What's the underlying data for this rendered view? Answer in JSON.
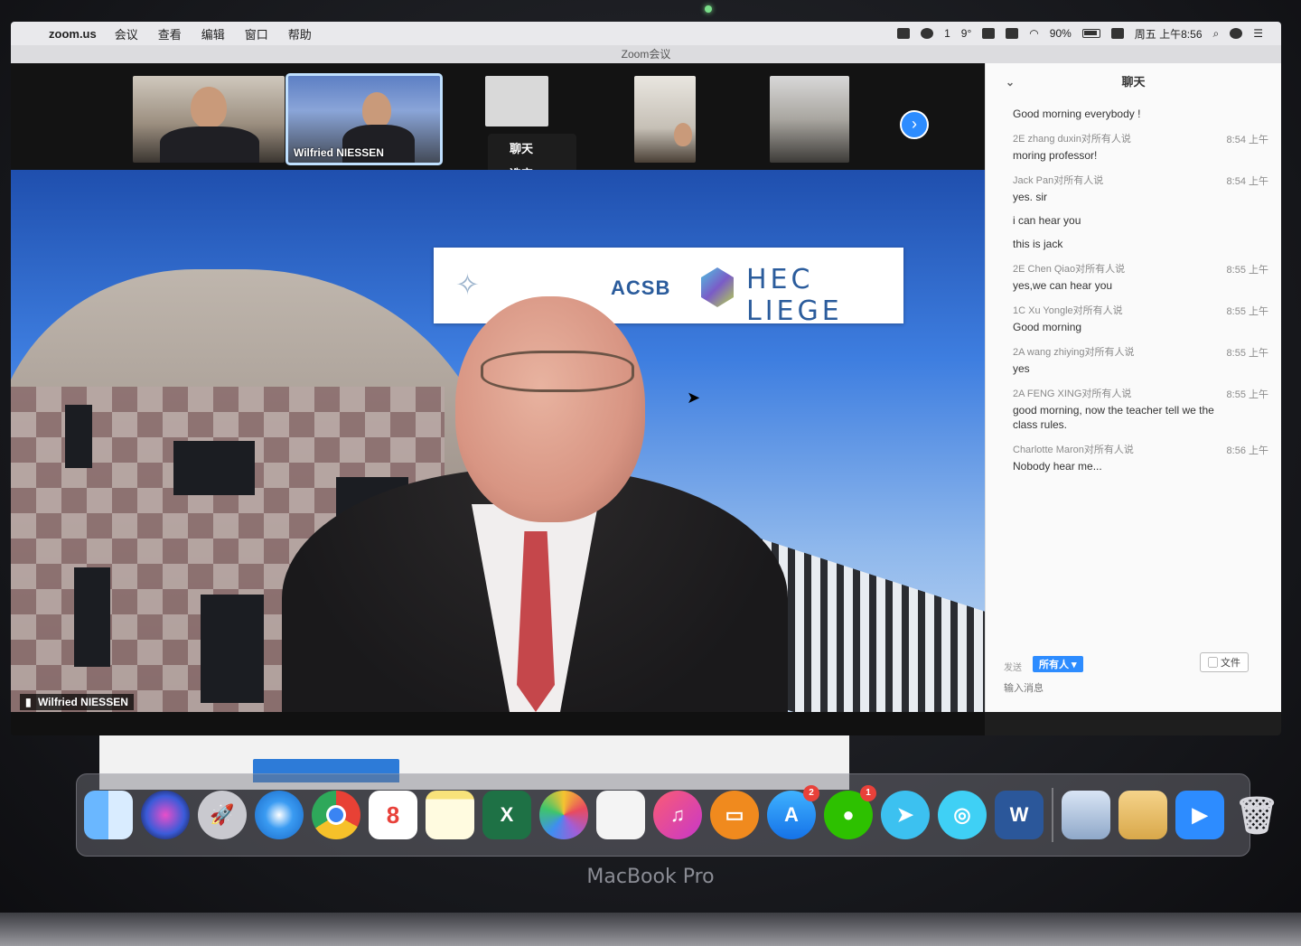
{
  "menubar": {
    "app_name": "zoom.us",
    "menus": [
      "会议",
      "查看",
      "编辑",
      "窗口",
      "帮助"
    ],
    "status_number": "1",
    "temperature": "9°",
    "battery": "90%",
    "clock": "周五 上午8:56"
  },
  "zoom": {
    "window_title": "Zoom会议",
    "gallery": {
      "thumb2_name": "Wilfried NIESSEN"
    },
    "context_menu": [
      "聊天",
      "选定"
    ],
    "main_video": {
      "speaker_name": "Wilfried NIESSEN",
      "banner_aacsb": "ACSB",
      "banner_hec": "HEC LIEGE"
    },
    "chat": {
      "title": "聊天",
      "messages": [
        {
          "sender": "",
          "time": "",
          "text": "Good morning everybody !"
        },
        {
          "sender": "2E zhang duxin对所有人说",
          "time": "8:54 上午",
          "text": "moring professor!"
        },
        {
          "sender": "Jack Pan对所有人说",
          "time": "8:54 上午",
          "text": "yes. sir"
        },
        {
          "sender": "",
          "time": "",
          "text": "i can hear you"
        },
        {
          "sender": "",
          "time": "",
          "text": "this is jack"
        },
        {
          "sender": "2E Chen Qiao对所有人说",
          "time": "8:55 上午",
          "text": "yes,we can hear you"
        },
        {
          "sender": "1C Xu Yongle对所有人说",
          "time": "8:55 上午",
          "text": "Good morning"
        },
        {
          "sender": "2A wang zhiying对所有人说",
          "time": "8:55 上午",
          "text": "yes"
        },
        {
          "sender": "2A FENG XING对所有人说",
          "time": "8:55 上午",
          "text": "good morning, now the teacher tell we the class rules."
        },
        {
          "sender": "Charlotte Maron对所有人说",
          "time": "8:56 上午",
          "text": "Nobody hear me..."
        }
      ],
      "to_label": "发送",
      "recipient": "所有人 ▾",
      "file_button": "文件",
      "input_placeholder": "输入消息"
    }
  },
  "dock": {
    "badges": {
      "appstore": "2",
      "wechat": "1"
    },
    "calendar_day": "8",
    "items": [
      "finder-icon",
      "siri-icon",
      "launchpad-icon",
      "safari-icon",
      "chrome-icon",
      "calendar-icon",
      "notes-icon",
      "excel-icon",
      "photos-icon",
      "textedit-icon",
      "music-icon",
      "books-icon",
      "appstore-icon",
      "wechat-icon",
      "feishu-icon",
      "qq-icon",
      "word-icon",
      "preview-icon",
      "folder-icon",
      "zoom-icon",
      "trash-icon"
    ]
  },
  "laptop_label": "MacBook Pro"
}
